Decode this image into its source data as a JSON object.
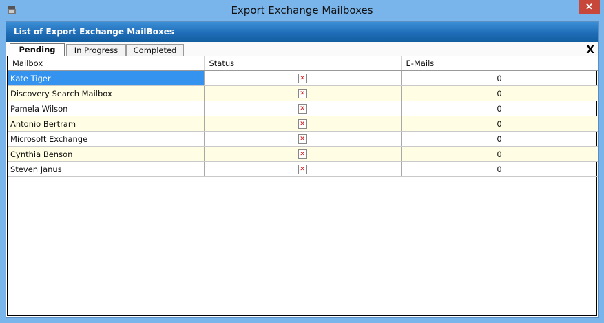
{
  "window": {
    "title": "Export Exchange Mailboxes",
    "close_label": "✕",
    "app_icon": "app-icon"
  },
  "banner": {
    "text": "List of Export Exchange MailBoxes"
  },
  "tabs": [
    {
      "label": "Pending",
      "active": true
    },
    {
      "label": "In Progress",
      "active": false
    },
    {
      "label": "Completed",
      "active": false
    }
  ],
  "tab_close_label": "X",
  "table": {
    "columns": [
      "Mailbox",
      "Status",
      "E-Mails"
    ],
    "rows": [
      {
        "mailbox": "Kate Tiger",
        "status_icon": "error-x-icon",
        "emails": "0"
      },
      {
        "mailbox": "Discovery Search Mailbox",
        "status_icon": "error-x-icon",
        "emails": "0"
      },
      {
        "mailbox": "Pamela Wilson",
        "status_icon": "error-x-icon",
        "emails": "0"
      },
      {
        "mailbox": "Antonio Bertram",
        "status_icon": "error-x-icon",
        "emails": "0"
      },
      {
        "mailbox": "Microsoft Exchange",
        "status_icon": "error-x-icon",
        "emails": "0"
      },
      {
        "mailbox": "Cynthia Benson",
        "status_icon": "error-x-icon",
        "emails": "0"
      },
      {
        "mailbox": "Steven Janus",
        "status_icon": "error-x-icon",
        "emails": "0"
      }
    ]
  },
  "colors": {
    "frame": "#79b4ea",
    "banner": "#1f6db8",
    "selected_row": "#3393ee",
    "alt_row": "#fffde3",
    "close_button": "#c7483a"
  }
}
